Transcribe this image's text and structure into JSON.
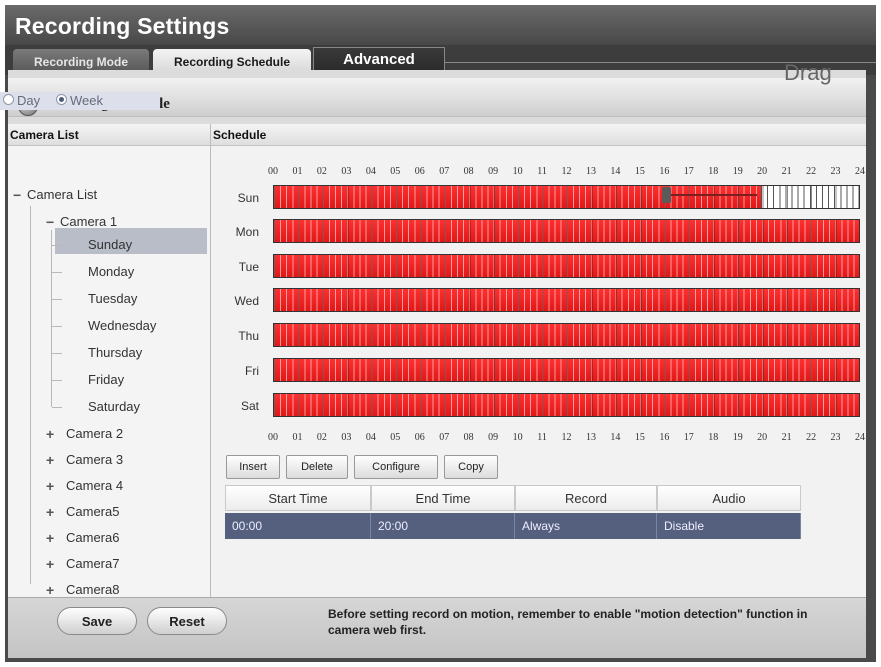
{
  "app": {
    "title": "Recording Settings"
  },
  "tabs": {
    "mode": "Recording Mode",
    "schedule": "Recording Schedule",
    "advanced": "Advanced"
  },
  "section": {
    "title": "Recording Schedule"
  },
  "columns": {
    "camera_list": "Camera List",
    "schedule": "Schedule",
    "drag_hint": "Drag"
  },
  "view_mode": {
    "day_label": "Day",
    "week_label": "Week",
    "selected": "Week"
  },
  "tree": {
    "root": "Camera List",
    "camera1": "Camera 1",
    "days": [
      "Sunday",
      "Monday",
      "Tuesday",
      "Wednesday",
      "Thursday",
      "Friday",
      "Saturday"
    ],
    "selected_day": "Sunday",
    "other_cameras": [
      "Camera 2",
      "Camera 3",
      "Camera 4",
      "Camera5",
      "Camera6",
      "Camera7",
      "Camera8"
    ]
  },
  "schedule": {
    "hours": [
      "00",
      "01",
      "02",
      "03",
      "04",
      "05",
      "06",
      "07",
      "08",
      "09",
      "10",
      "11",
      "12",
      "13",
      "14",
      "15",
      "16",
      "17",
      "18",
      "19",
      "20",
      "21",
      "22",
      "23",
      "24"
    ],
    "days": [
      "Sun",
      "Mon",
      "Tue",
      "Wed",
      "Thu",
      "Fri",
      "Sat"
    ],
    "sunday_recorded_until_hour": 20,
    "record_color": "#ff2222"
  },
  "buttons": {
    "insert": "Insert",
    "delete": "Delete",
    "configure": "Configure",
    "copy": "Copy",
    "save": "Save",
    "reset": "Reset"
  },
  "table": {
    "headers": [
      "Start Time",
      "End Time",
      "Record",
      "Audio"
    ],
    "rows": [
      {
        "start": "00:00",
        "end": "20:00",
        "record": "Always",
        "audio": "Disable"
      }
    ]
  },
  "notice": "Before setting record on motion, remember to enable \"motion detection\" function in camera web first."
}
